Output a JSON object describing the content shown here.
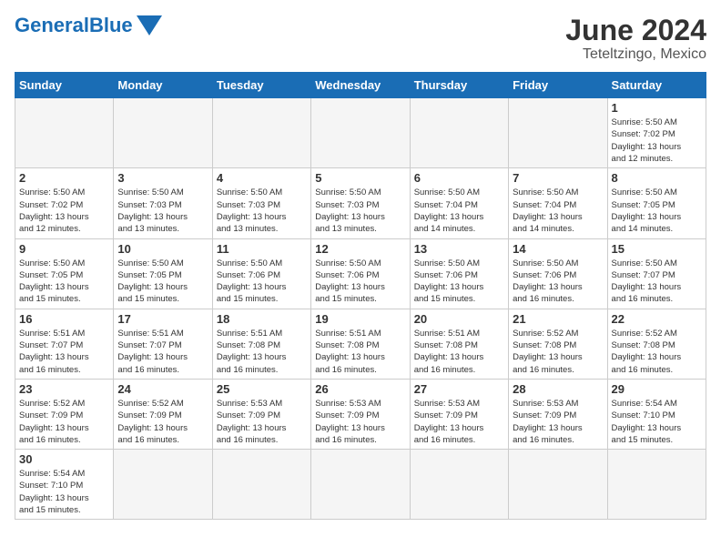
{
  "header": {
    "logo_general": "General",
    "logo_blue": "Blue",
    "month_title": "June 2024",
    "location": "Teteltzingo, Mexico"
  },
  "days_of_week": [
    "Sunday",
    "Monday",
    "Tuesday",
    "Wednesday",
    "Thursday",
    "Friday",
    "Saturday"
  ],
  "days": [
    {
      "num": "",
      "info": ""
    },
    {
      "num": "",
      "info": ""
    },
    {
      "num": "",
      "info": ""
    },
    {
      "num": "",
      "info": ""
    },
    {
      "num": "",
      "info": ""
    },
    {
      "num": "",
      "info": ""
    },
    {
      "num": "1",
      "info": "Sunrise: 5:50 AM\nSunset: 7:02 PM\nDaylight: 13 hours\nand 12 minutes."
    },
    {
      "num": "2",
      "info": "Sunrise: 5:50 AM\nSunset: 7:02 PM\nDaylight: 13 hours\nand 12 minutes."
    },
    {
      "num": "3",
      "info": "Sunrise: 5:50 AM\nSunset: 7:03 PM\nDaylight: 13 hours\nand 13 minutes."
    },
    {
      "num": "4",
      "info": "Sunrise: 5:50 AM\nSunset: 7:03 PM\nDaylight: 13 hours\nand 13 minutes."
    },
    {
      "num": "5",
      "info": "Sunrise: 5:50 AM\nSunset: 7:03 PM\nDaylight: 13 hours\nand 13 minutes."
    },
    {
      "num": "6",
      "info": "Sunrise: 5:50 AM\nSunset: 7:04 PM\nDaylight: 13 hours\nand 14 minutes."
    },
    {
      "num": "7",
      "info": "Sunrise: 5:50 AM\nSunset: 7:04 PM\nDaylight: 13 hours\nand 14 minutes."
    },
    {
      "num": "8",
      "info": "Sunrise: 5:50 AM\nSunset: 7:05 PM\nDaylight: 13 hours\nand 14 minutes."
    },
    {
      "num": "9",
      "info": "Sunrise: 5:50 AM\nSunset: 7:05 PM\nDaylight: 13 hours\nand 15 minutes."
    },
    {
      "num": "10",
      "info": "Sunrise: 5:50 AM\nSunset: 7:05 PM\nDaylight: 13 hours\nand 15 minutes."
    },
    {
      "num": "11",
      "info": "Sunrise: 5:50 AM\nSunset: 7:06 PM\nDaylight: 13 hours\nand 15 minutes."
    },
    {
      "num": "12",
      "info": "Sunrise: 5:50 AM\nSunset: 7:06 PM\nDaylight: 13 hours\nand 15 minutes."
    },
    {
      "num": "13",
      "info": "Sunrise: 5:50 AM\nSunset: 7:06 PM\nDaylight: 13 hours\nand 15 minutes."
    },
    {
      "num": "14",
      "info": "Sunrise: 5:50 AM\nSunset: 7:06 PM\nDaylight: 13 hours\nand 16 minutes."
    },
    {
      "num": "15",
      "info": "Sunrise: 5:50 AM\nSunset: 7:07 PM\nDaylight: 13 hours\nand 16 minutes."
    },
    {
      "num": "16",
      "info": "Sunrise: 5:51 AM\nSunset: 7:07 PM\nDaylight: 13 hours\nand 16 minutes."
    },
    {
      "num": "17",
      "info": "Sunrise: 5:51 AM\nSunset: 7:07 PM\nDaylight: 13 hours\nand 16 minutes."
    },
    {
      "num": "18",
      "info": "Sunrise: 5:51 AM\nSunset: 7:08 PM\nDaylight: 13 hours\nand 16 minutes."
    },
    {
      "num": "19",
      "info": "Sunrise: 5:51 AM\nSunset: 7:08 PM\nDaylight: 13 hours\nand 16 minutes."
    },
    {
      "num": "20",
      "info": "Sunrise: 5:51 AM\nSunset: 7:08 PM\nDaylight: 13 hours\nand 16 minutes."
    },
    {
      "num": "21",
      "info": "Sunrise: 5:52 AM\nSunset: 7:08 PM\nDaylight: 13 hours\nand 16 minutes."
    },
    {
      "num": "22",
      "info": "Sunrise: 5:52 AM\nSunset: 7:08 PM\nDaylight: 13 hours\nand 16 minutes."
    },
    {
      "num": "23",
      "info": "Sunrise: 5:52 AM\nSunset: 7:09 PM\nDaylight: 13 hours\nand 16 minutes."
    },
    {
      "num": "24",
      "info": "Sunrise: 5:52 AM\nSunset: 7:09 PM\nDaylight: 13 hours\nand 16 minutes."
    },
    {
      "num": "25",
      "info": "Sunrise: 5:53 AM\nSunset: 7:09 PM\nDaylight: 13 hours\nand 16 minutes."
    },
    {
      "num": "26",
      "info": "Sunrise: 5:53 AM\nSunset: 7:09 PM\nDaylight: 13 hours\nand 16 minutes."
    },
    {
      "num": "27",
      "info": "Sunrise: 5:53 AM\nSunset: 7:09 PM\nDaylight: 13 hours\nand 16 minutes."
    },
    {
      "num": "28",
      "info": "Sunrise: 5:53 AM\nSunset: 7:09 PM\nDaylight: 13 hours\nand 16 minutes."
    },
    {
      "num": "29",
      "info": "Sunrise: 5:54 AM\nSunset: 7:10 PM\nDaylight: 13 hours\nand 15 minutes."
    },
    {
      "num": "30",
      "info": "Sunrise: 5:54 AM\nSunset: 7:10 PM\nDaylight: 13 hours\nand 15 minutes."
    }
  ]
}
